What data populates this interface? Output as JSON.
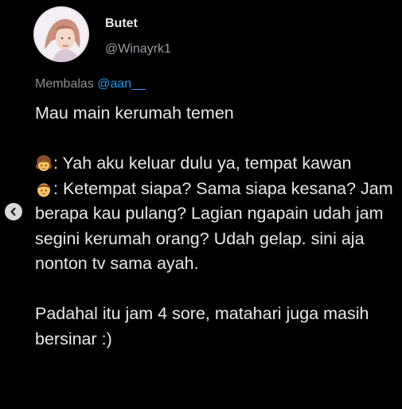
{
  "user": {
    "display_name": "Butet",
    "handle": "@Winayrk1"
  },
  "reply": {
    "prefix": "Membalas ",
    "mention": "@aan__"
  },
  "tweet": {
    "line1": "Mau main kerumah temen",
    "girl_emoji_icon": "girl-emoji-icon",
    "girl_text": ": Yah aku keluar dulu ya, tempat kawan",
    "boy_emoji_icon": "boy-emoji-icon",
    "boy_text": ": Ketempat siapa? Sama siapa kesana? Jam berapa kau pulang? Lagian ngapain udah jam segini kerumah orang? Udah gelap. sini aja nonton tv sama ayah.",
    "closing": "Padahal itu jam 4 sore, matahari  juga masih bersinar :)"
  },
  "icons": {
    "nav": "chevron-left-icon"
  },
  "colors": {
    "background": "#000000",
    "text": "#e7e9ea",
    "secondary_text": "#9a9fa4",
    "mention": "#1d9bf0"
  }
}
